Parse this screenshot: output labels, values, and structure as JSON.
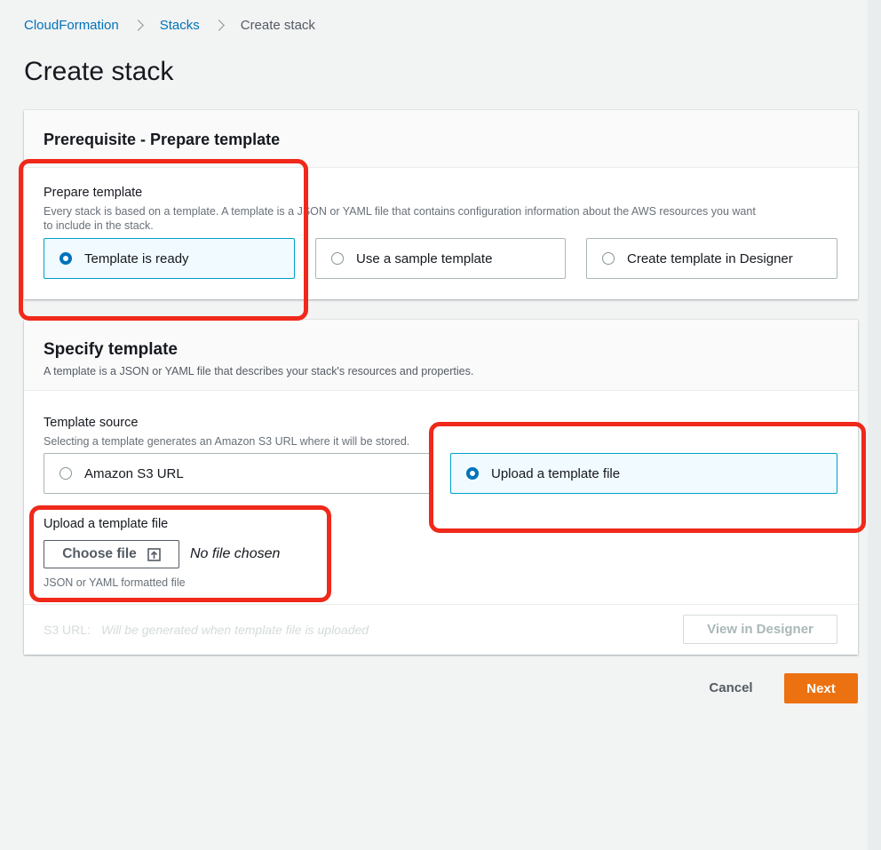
{
  "breadcrumb": {
    "items": [
      "CloudFormation",
      "Stacks"
    ],
    "current": "Create stack"
  },
  "page": {
    "title": "Create stack"
  },
  "prerequisite": {
    "title": "Prerequisite - Prepare template",
    "field_label": "Prepare template",
    "field_desc_line1": "Every stack is based on a template. A template is a JSON or YAML file that contains configuration information about the AWS resources you want",
    "field_desc_line2": "to include in the stack.",
    "options": [
      "Template is ready",
      "Use a sample template",
      "Create template in Designer"
    ],
    "selected": "Template is ready"
  },
  "specify": {
    "title": "Specify template",
    "desc": "A template is a JSON or YAML file that describes your stack's resources and properties.",
    "source_label": "Template source",
    "source_desc": "Selecting a template generates an Amazon S3 URL where it will be stored.",
    "options": [
      "Amazon S3 URL",
      "Upload a template file"
    ],
    "selected": "Upload a template file",
    "upload_label": "Upload a template file",
    "choose_file_label": "Choose file",
    "no_file_text": "No file chosen",
    "upload_hint": "JSON or YAML formatted file",
    "s3_url_label": "S3 URL:",
    "s3_url_value": "Will be generated when template file is uploaded",
    "view_designer_label": "View in Designer"
  },
  "actions": {
    "cancel_label": "Cancel",
    "next_label": "Next"
  },
  "colors": {
    "link": "#0073bb",
    "primary": "#ec7211",
    "selected_border": "#00a1c9",
    "annotation": "#f0291a"
  }
}
